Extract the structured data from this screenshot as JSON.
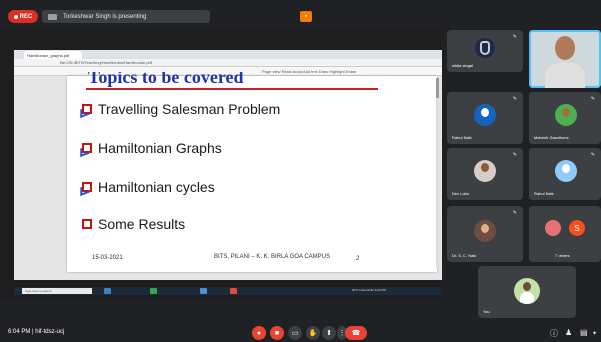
{
  "topbar": {
    "rec_label": "REC",
    "presenting_text": "Torkeshwar Singh is presenting"
  },
  "browser": {
    "tab_title": "Hamiltonian_graphs.pdf",
    "window_controls": "– ◻ ✕",
    "address": "file:///D:/BITS/Teaching/Hamiltonian/Hamiltonian.pdf",
    "toolbar_text": "Page view   Read aloud   Add text   Draw   Highlight   Erase"
  },
  "slide": {
    "title": "Topics to be covered",
    "bullets": [
      "Travelling Salesman Problem",
      "Hamiltonian Graphs",
      "Hamiltonian cycles",
      "Some Results"
    ],
    "footer_date": "15-03-2021",
    "footer_center": "BITS, PILANI – K. K. BIRLA GOA CAMPUS",
    "footer_page": "2"
  },
  "taskbar": {
    "search_placeholder": "Type here to search",
    "tray_text": "30°C Haze  ENG  6:04 PM"
  },
  "participants": [
    {
      "name": "nikita singal"
    },
    {
      "name": ""
    },
    {
      "name": "Rahul Naik"
    },
    {
      "name": "Mahesh Gawdhone"
    },
    {
      "name": "Dev Lobo"
    },
    {
      "name": "Rahul Naik"
    },
    {
      "name": "Dr. S. C. Naik"
    },
    {
      "name": "7 others"
    },
    {
      "name": "You"
    }
  ],
  "others_badge": "S",
  "bottombar": {
    "clock": "6:04 PM",
    "separator": "|",
    "meeting_code": "hif-tdsz-ucj"
  },
  "colors": {
    "background": "#202124",
    "tile": "#3c4043",
    "rec": "#d93025",
    "hangup": "#ea4335",
    "slide_title": "#2233aa",
    "bullet_box": "#cc1111"
  }
}
